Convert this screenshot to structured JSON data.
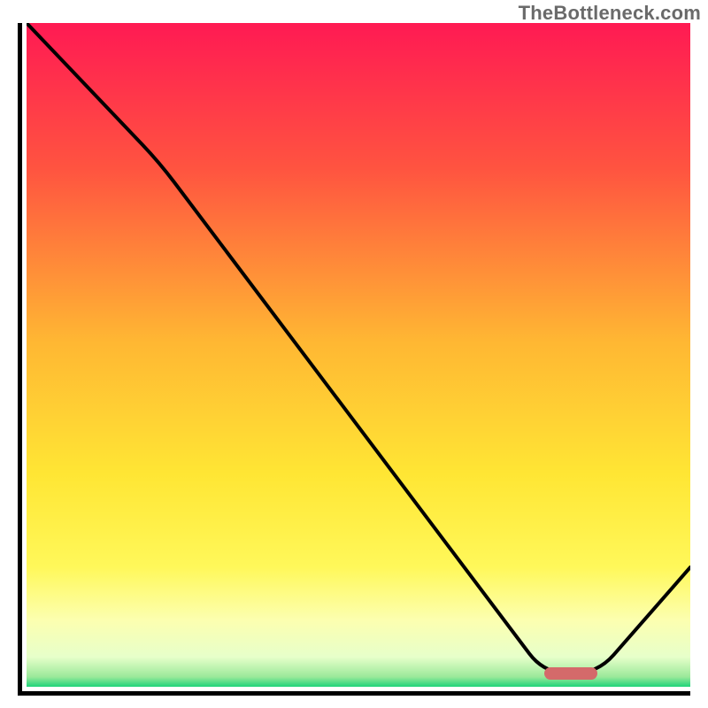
{
  "attribution": "TheBottleneck.com",
  "chart_data": {
    "type": "line",
    "title": "",
    "xlabel": "",
    "ylabel": "",
    "xlim": [
      0,
      100
    ],
    "ylim": [
      0,
      100
    ],
    "series": [
      {
        "name": "curve",
        "x": [
          0,
          20,
          78,
          86,
          100
        ],
        "values": [
          100,
          79,
          2,
          2,
          18
        ]
      }
    ],
    "marker": {
      "x_start": 78,
      "x_end": 86,
      "y": 2,
      "color": "#d46a6a"
    },
    "background_gradient": {
      "stops": [
        {
          "offset": 0.0,
          "color": "#ff1a53"
        },
        {
          "offset": 0.22,
          "color": "#ff5440"
        },
        {
          "offset": 0.48,
          "color": "#ffb733"
        },
        {
          "offset": 0.68,
          "color": "#ffe634"
        },
        {
          "offset": 0.82,
          "color": "#fff85a"
        },
        {
          "offset": 0.9,
          "color": "#fcffb0"
        },
        {
          "offset": 0.955,
          "color": "#e7ffca"
        },
        {
          "offset": 0.985,
          "color": "#9be99a"
        },
        {
          "offset": 1.0,
          "color": "#1ed47a"
        }
      ]
    }
  }
}
